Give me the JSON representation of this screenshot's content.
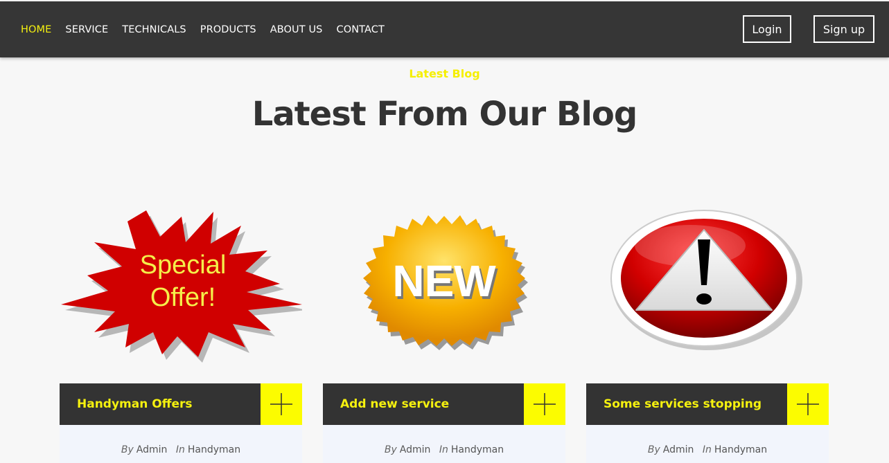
{
  "nav": {
    "links": [
      {
        "label": "HOME",
        "active": true
      },
      {
        "label": "SERVICE"
      },
      {
        "label": "TECHNICALS"
      },
      {
        "label": "PRODUCTS"
      },
      {
        "label": "ABOUT US"
      },
      {
        "label": "CONTACT"
      }
    ],
    "login_label": "Login",
    "signup_label": "Sign up"
  },
  "section": {
    "tag": "Latest Blog",
    "title": "Latest From Our Blog"
  },
  "cards": [
    {
      "image_text": [
        "Special",
        "Offer!"
      ],
      "title": "Handyman Offers",
      "by_label": "By",
      "author": "Admin",
      "in_label": "In",
      "category": "Handyman"
    },
    {
      "image_text": [
        "NEW"
      ],
      "title": "Add new service",
      "by_label": "By",
      "author": "Admin",
      "in_label": "In",
      "category": "Handyman"
    },
    {
      "image_text": [],
      "title": "Some services stopping",
      "by_label": "By",
      "author": "Admin",
      "in_label": "In",
      "category": "Handyman"
    }
  ],
  "colors": {
    "nav_bg": "#363636",
    "accent_yellow": "#f5f10f",
    "card_head_bg": "#333333",
    "plus_bg": "#fcfc00",
    "meta_bg": "#f2f5fc"
  },
  "icons": [
    "plus-icon",
    "special-offer-burst-icon",
    "new-badge-icon",
    "warning-sign-icon"
  ]
}
